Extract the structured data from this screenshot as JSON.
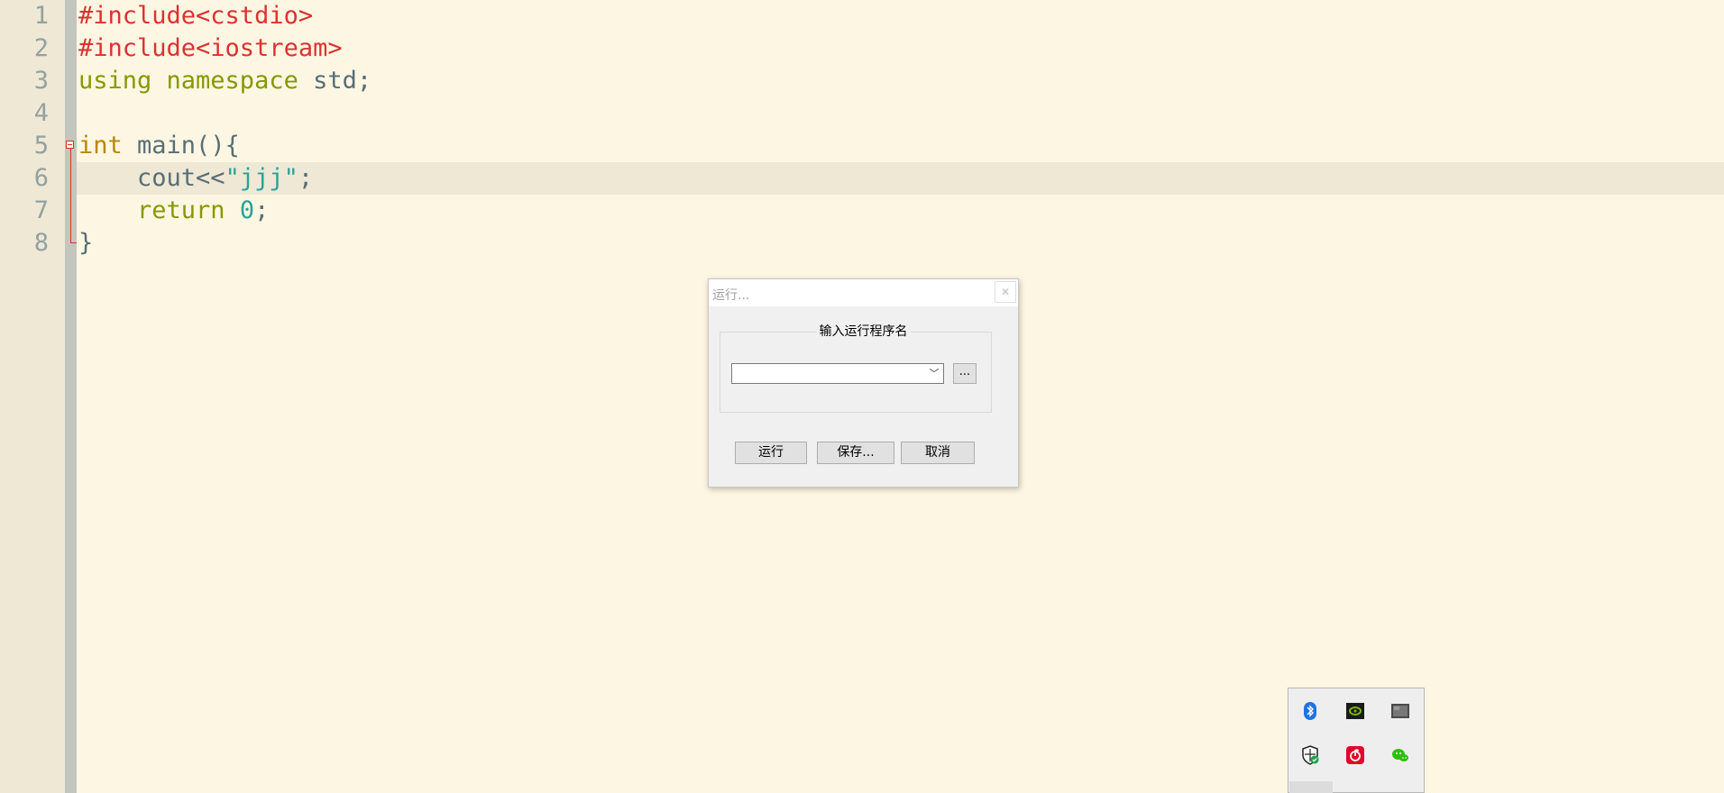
{
  "editor": {
    "line_numbers": [
      "1",
      "2",
      "3",
      "4",
      "5",
      "6",
      "7",
      "8"
    ],
    "lines": [
      [
        {
          "t": "#include<cstdio>",
          "c": "pre"
        }
      ],
      [
        {
          "t": "#include<iostream>",
          "c": "pre"
        }
      ],
      [
        {
          "t": "using namespace",
          "c": "kw"
        },
        {
          "t": " std;",
          "c": "plain"
        }
      ],
      [],
      [
        {
          "t": "int",
          "c": "type"
        },
        {
          "t": " main(){",
          "c": "plain"
        }
      ],
      [
        {
          "t": "    cout<<",
          "c": "plain"
        },
        {
          "t": "\"jjj\"",
          "c": "str"
        },
        {
          "t": ";",
          "c": "plain"
        }
      ],
      [
        {
          "t": "    return",
          "c": "kw"
        },
        {
          "t": " ",
          "c": "plain"
        },
        {
          "t": "0",
          "c": "num"
        },
        {
          "t": ";",
          "c": "plain"
        }
      ],
      [
        {
          "t": "}",
          "c": "plain"
        }
      ]
    ],
    "current_line": 6,
    "colors": {
      "background": "#fdf6e3",
      "gutter": "#eee8d5",
      "preprocessor": "#dc322f",
      "keyword": "#859900",
      "type": "#b58900",
      "string": "#2aa198",
      "text": "#586e75"
    }
  },
  "dialog": {
    "title": "运行...",
    "close_glyph": "✕",
    "group_label": "输入运行程序名",
    "combo_value": "",
    "combo_arrow": "﹀",
    "browse_label": "...",
    "run_label": "运行",
    "save_label": "保存...",
    "cancel_label": "取消"
  },
  "tray": {
    "icons": [
      "bluetooth-icon",
      "nvidia-icon",
      "display-icon",
      "security-shield-icon",
      "netease-music-icon",
      "wechat-icon"
    ]
  }
}
